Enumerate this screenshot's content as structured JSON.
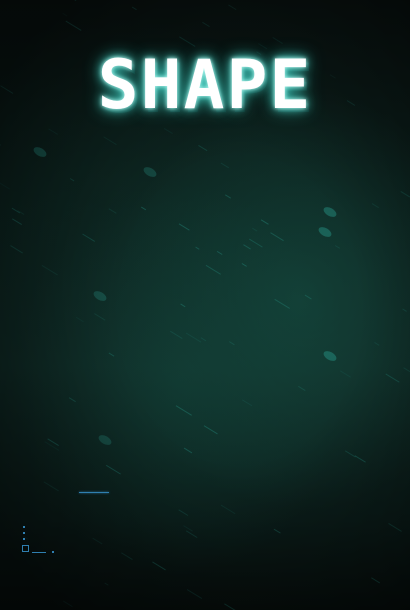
{
  "game": {
    "title": "SHAPE"
  },
  "colors": {
    "background": "#0d2420",
    "title_glow": "#4fe0d2",
    "hud_accent": "#2f7fb0",
    "particle": "#2fb4a4"
  }
}
